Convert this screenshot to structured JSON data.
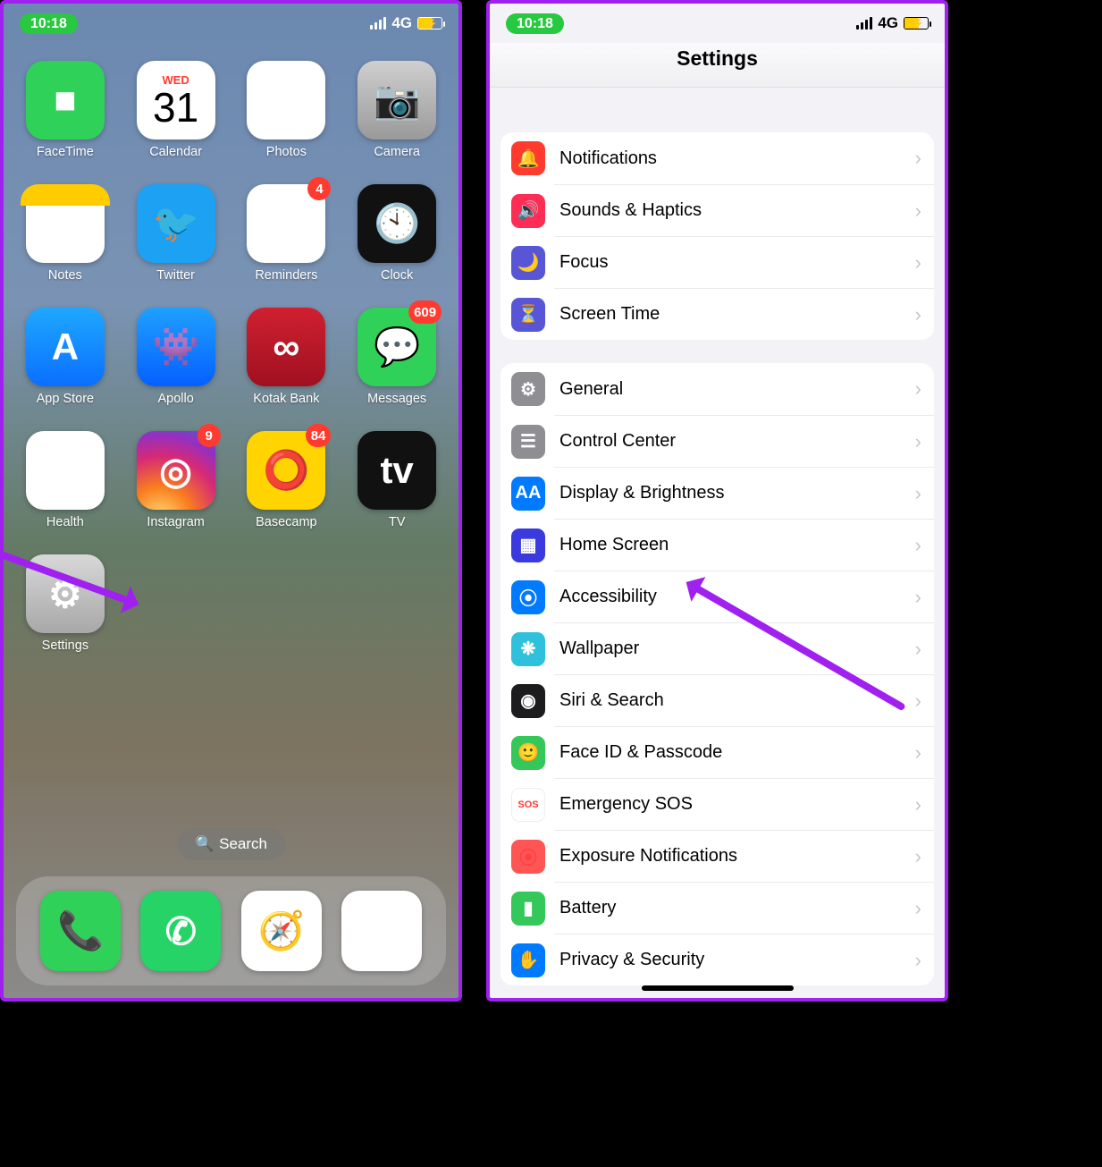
{
  "status": {
    "time": "10:18",
    "network": "4G"
  },
  "home": {
    "calendar": {
      "dow": "WED",
      "day": "31"
    },
    "apps": [
      {
        "label": "FaceTime",
        "cls": "ic-facetime",
        "glyph": "■"
      },
      {
        "label": "Calendar",
        "cls": "ic-calendar",
        "glyph": ""
      },
      {
        "label": "Photos",
        "cls": "ic-photos",
        "glyph": "✿"
      },
      {
        "label": "Camera",
        "cls": "ic-camera",
        "glyph": "📷"
      },
      {
        "label": "Notes",
        "cls": "ic-notes",
        "glyph": ""
      },
      {
        "label": "Twitter",
        "cls": "ic-twitter",
        "glyph": "🐦"
      },
      {
        "label": "Reminders",
        "cls": "ic-reminders",
        "glyph": "≣",
        "badge": "4"
      },
      {
        "label": "Clock",
        "cls": "ic-clock",
        "glyph": "🕙"
      },
      {
        "label": "App Store",
        "cls": "ic-appstore",
        "glyph": "A"
      },
      {
        "label": "Apollo",
        "cls": "ic-apollo",
        "glyph": "👾"
      },
      {
        "label": "Kotak Bank",
        "cls": "ic-kotak",
        "glyph": "∞"
      },
      {
        "label": "Messages",
        "cls": "ic-messages",
        "glyph": "💬",
        "badge": "609"
      },
      {
        "label": "Health",
        "cls": "ic-health",
        "glyph": "❤"
      },
      {
        "label": "Instagram",
        "cls": "ic-instagram",
        "glyph": "◎",
        "badge": "9"
      },
      {
        "label": "Basecamp",
        "cls": "ic-basecamp",
        "glyph": "⭕",
        "badge": "84"
      },
      {
        "label": "TV",
        "cls": "ic-tv",
        "glyph": "tv"
      },
      {
        "label": "Settings",
        "cls": "ic-settings",
        "glyph": "⚙"
      }
    ],
    "search": "Search",
    "dock": [
      {
        "name": "phone",
        "cls": "ic-phone",
        "glyph": "📞"
      },
      {
        "name": "whatsapp",
        "cls": "ic-whatsapp",
        "glyph": "✆"
      },
      {
        "name": "safari",
        "cls": "ic-safari",
        "glyph": "🧭"
      },
      {
        "name": "yt-music",
        "cls": "ic-ytmusic",
        "glyph": "▶"
      }
    ]
  },
  "settings": {
    "title": "Settings",
    "group1": [
      {
        "label": "Notifications",
        "cls": "c-red",
        "glyph": "🔔"
      },
      {
        "label": "Sounds & Haptics",
        "cls": "c-pink",
        "glyph": "🔊"
      },
      {
        "label": "Focus",
        "cls": "c-purple",
        "glyph": "🌙"
      },
      {
        "label": "Screen Time",
        "cls": "c-purple",
        "glyph": "⏳"
      }
    ],
    "group2": [
      {
        "label": "General",
        "cls": "c-gray",
        "glyph": "⚙"
      },
      {
        "label": "Control Center",
        "cls": "c-gray",
        "glyph": "☰"
      },
      {
        "label": "Display & Brightness",
        "cls": "c-blue",
        "glyph": "AA"
      },
      {
        "label": "Home Screen",
        "cls": "c-homescreen",
        "glyph": "▦"
      },
      {
        "label": "Accessibility",
        "cls": "c-blue",
        "glyph": "⦿"
      },
      {
        "label": "Wallpaper",
        "cls": "c-cyan",
        "glyph": "❋"
      },
      {
        "label": "Siri & Search",
        "cls": "c-dark",
        "glyph": "◉"
      },
      {
        "label": "Face ID & Passcode",
        "cls": "c-green",
        "glyph": "🙂"
      },
      {
        "label": "Emergency SOS",
        "cls": "c-sos",
        "glyph": "SOS"
      },
      {
        "label": "Exposure Notifications",
        "cls": "c-expred",
        "glyph": "⦿"
      },
      {
        "label": "Battery",
        "cls": "c-green",
        "glyph": "▮"
      },
      {
        "label": "Privacy & Security",
        "cls": "c-hand",
        "glyph": "✋"
      }
    ]
  }
}
